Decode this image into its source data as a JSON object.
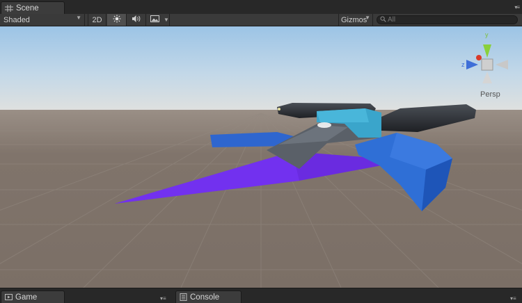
{
  "scene_tab": {
    "label": "Scene",
    "icon": "scene-grid-icon"
  },
  "toolbar": {
    "shading_mode": "Shaded",
    "mode_2d_label": "2D",
    "lighting_icon": "sun-icon",
    "audio_icon": "speaker-icon",
    "effects_icon": "image-effects-icon",
    "gizmos_label": "Gizmos",
    "search_placeholder": "All"
  },
  "viewport": {
    "projection_label": "Persp",
    "gizmo_axes": {
      "y": "y",
      "z": "z"
    },
    "colors": {
      "sky_top": "#9fc6e8",
      "horizon": "#d9d9d9",
      "ground": "#7d7065",
      "purple": "#6a2be0",
      "blue": "#2f6fd6",
      "teal": "#39a3c9"
    }
  },
  "bottom_tabs": [
    {
      "label": "Game",
      "icon": "game-icon"
    },
    {
      "label": "Console",
      "icon": "console-icon"
    }
  ]
}
